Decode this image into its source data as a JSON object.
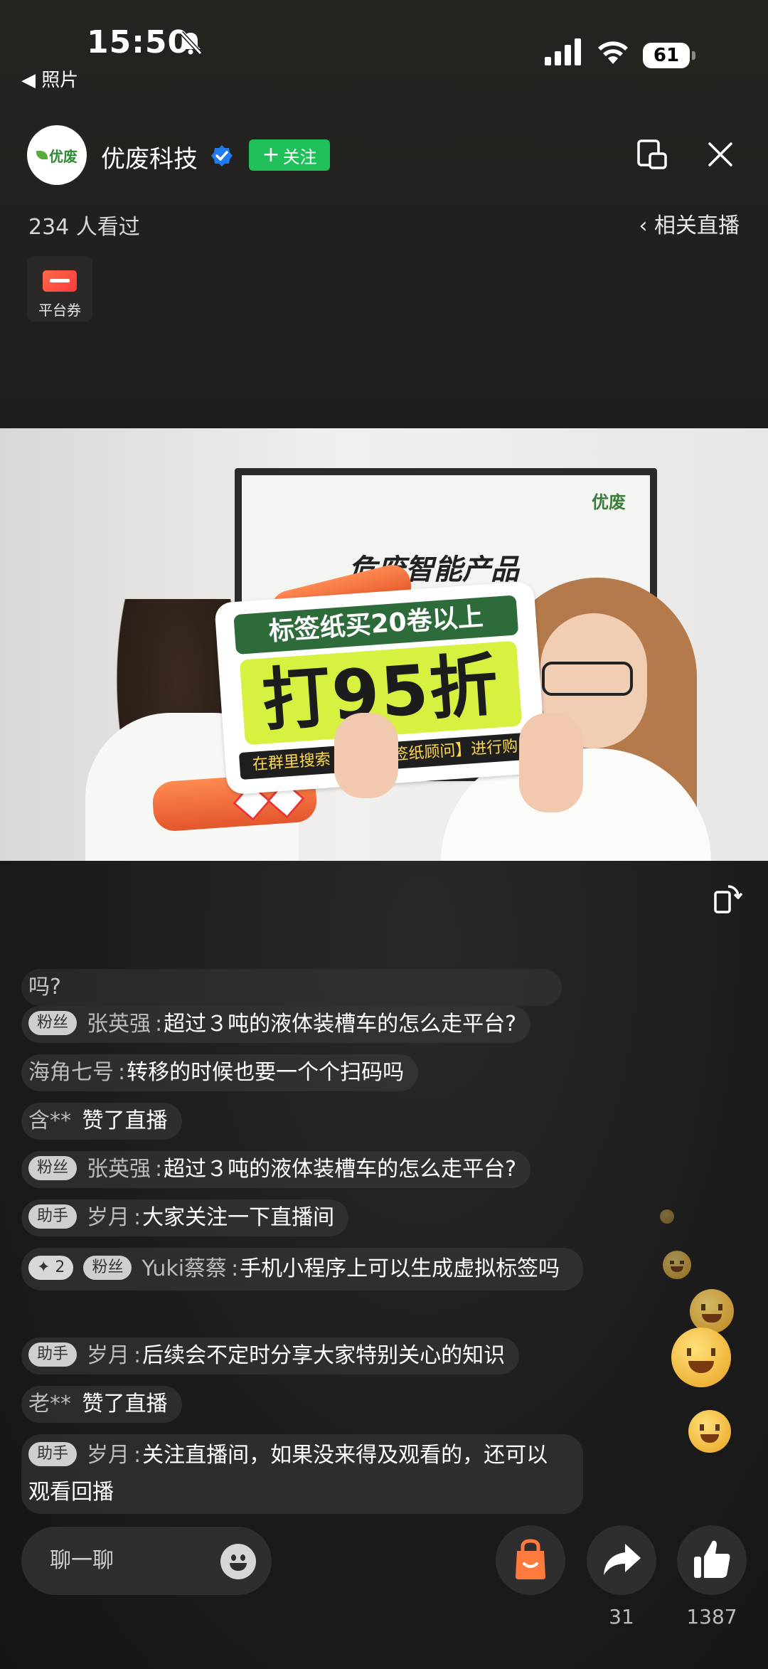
{
  "status_bar": {
    "time": "15:50",
    "back_label": "照片",
    "battery": "61"
  },
  "header": {
    "host_name": "优废科技",
    "logo_text": "优废",
    "follow_label": "关注",
    "viewers": "234 人看过",
    "related_label": "相关直播",
    "coupon_label": "平台券"
  },
  "video": {
    "tv_brand": "优废",
    "tv_title": "危废智能产品",
    "sign_top": "标签纸买20卷以上",
    "sign_big": "打95折",
    "sign_bottom": "在群里搜索【优废标签纸顾问】进行购"
  },
  "comments": [
    {
      "text": "吗?"
    },
    {
      "badge": "粉丝",
      "user": "张英强",
      "text": "超过３吨的液体装槽车的怎么走平台?"
    },
    {
      "user": "海角七号",
      "text": "转移的时候也要一个个扫码吗"
    },
    {
      "user": "含**",
      "text": "赞了直播"
    },
    {
      "badge": "粉丝",
      "user": "张英强",
      "text": "超过３吨的液体装槽车的怎么走平台?"
    },
    {
      "badge": "助手",
      "user": "岁月",
      "text": "大家关注一下直播间"
    },
    {
      "level": "✦ 2",
      "badge": "粉丝",
      "user": "Yuki蔡蔡",
      "text": "手机小程序上可以生成虚拟标签吗"
    },
    {
      "badge": "助手",
      "user": "岁月",
      "text": "后续会不定时分享大家特别关心的知识"
    },
    {
      "user": "老**",
      "text": "赞了直播"
    },
    {
      "badge": "助手",
      "user": "岁月",
      "text": "关注直播间，如果没来得及观看的，还可以观看回播"
    }
  ],
  "bottom_bar": {
    "chat_placeholder": "聊一聊",
    "share_count": "31",
    "like_count": "1387"
  },
  "colors": {
    "follow_green": "#1fbf5a",
    "verified_blue": "#1e7bf2",
    "shop_orange": "#ff7a3d"
  }
}
